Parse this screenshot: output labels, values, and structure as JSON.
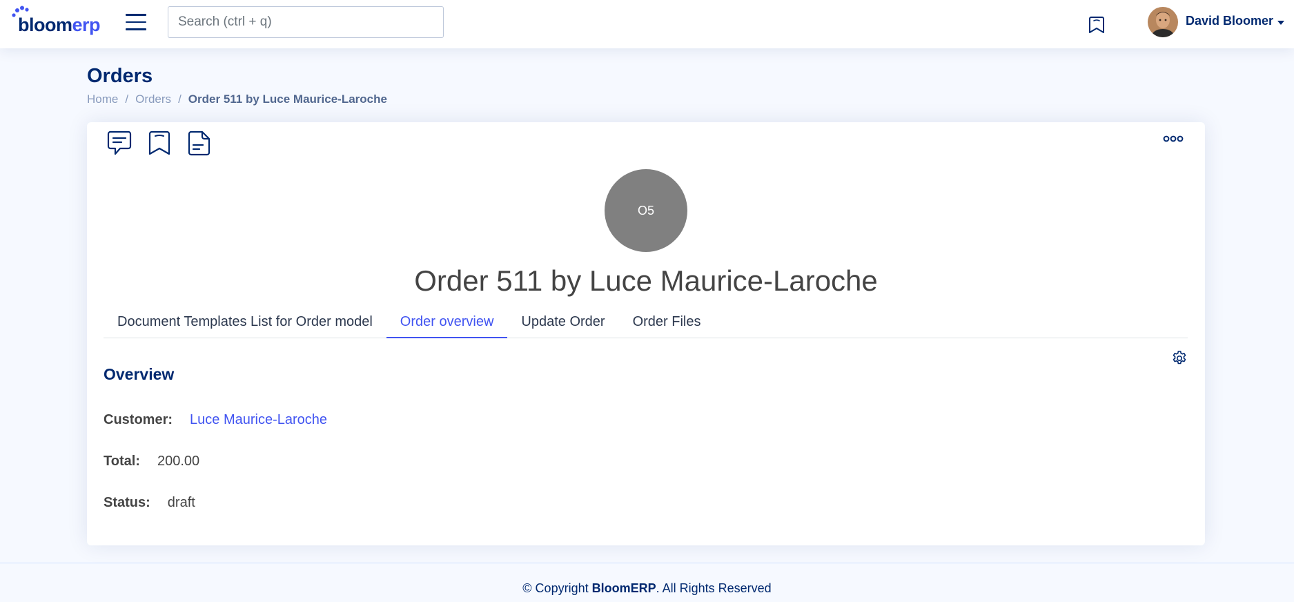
{
  "header": {
    "logo_part1": "bloom",
    "logo_part2": "erp",
    "search_placeholder": "Search (ctrl + q)",
    "user_name": "David Bloomer"
  },
  "page": {
    "title": "Orders",
    "breadcrumb": [
      "Home",
      "Orders",
      "Order 511 by Luce Maurice-Laroche"
    ],
    "breadcrumb_sep": "/"
  },
  "record": {
    "initials": "O5",
    "title": "Order 511 by Luce Maurice-Laroche",
    "tabs": [
      {
        "label": "Document Templates List for Order model",
        "active": false
      },
      {
        "label": "Order overview",
        "active": true
      },
      {
        "label": "Update Order",
        "active": false
      },
      {
        "label": "Order Files",
        "active": false
      }
    ],
    "section_title": "Overview",
    "fields": {
      "customer_label": "Customer:",
      "customer_value": "Luce Maurice-Laroche",
      "total_label": "Total:",
      "total_value": "200.00",
      "status_label": "Status:",
      "status_value": "draft"
    }
  },
  "footer": {
    "prefix": "© Copyright ",
    "brand": "BloomERP",
    "suffix": ". All Rights Reserved"
  },
  "colors": {
    "primary": "#4154f1",
    "navy": "#012970",
    "avatar_gray": "#808080",
    "background": "#f6f9ff"
  },
  "icons": [
    "hamburger-menu-icon",
    "bookmark-icon",
    "comment-icon",
    "document-icon",
    "more-horizontal-icon",
    "gear-icon"
  ]
}
